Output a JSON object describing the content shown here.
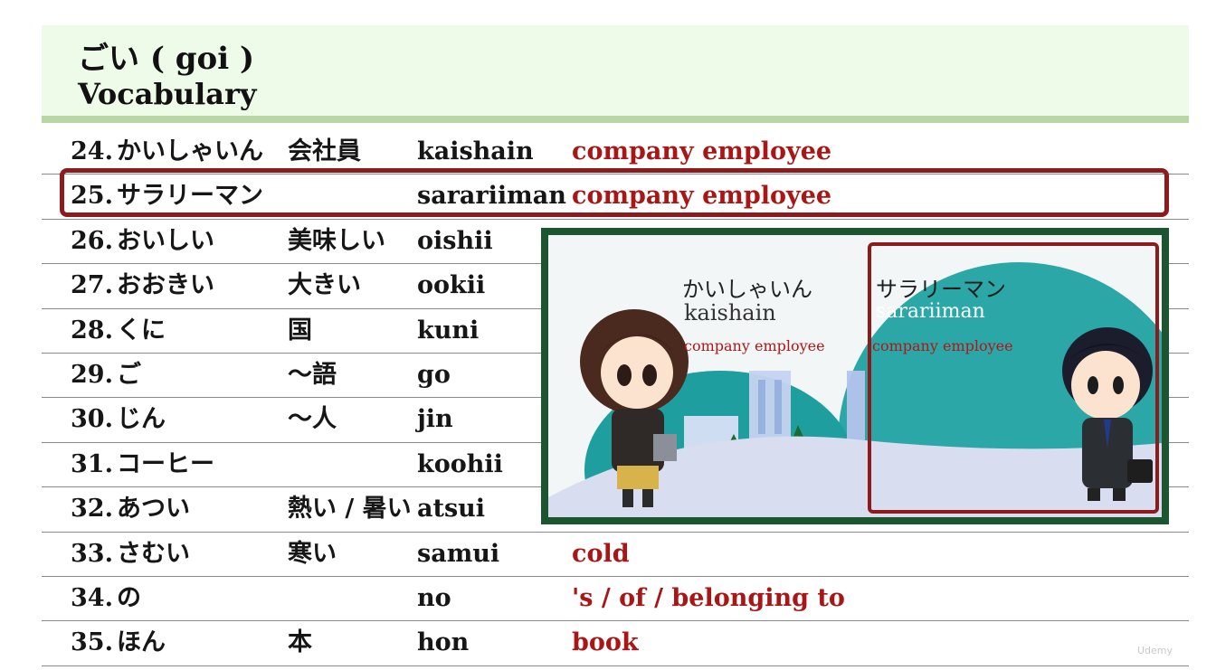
{
  "header": {
    "title_jp": "ごい ( goi )",
    "title_en": "Vocabulary"
  },
  "rows": [
    {
      "num": "24.",
      "kana": "かいしゃいん",
      "kanji": "会社員",
      "romaji": "kaishain",
      "english": "company employee"
    },
    {
      "num": "25.",
      "kana": "サラリーマン",
      "kanji": "",
      "romaji": "sarariiman",
      "english": "company employee"
    },
    {
      "num": "26.",
      "kana": "おいしい",
      "kanji": "美味しい",
      "romaji": "oishii",
      "english": ""
    },
    {
      "num": "27.",
      "kana": "おおきい",
      "kanji": "大きい",
      "romaji": "ookii",
      "english": ""
    },
    {
      "num": "28.",
      "kana": "くに",
      "kanji": "国",
      "romaji": "kuni",
      "english": ""
    },
    {
      "num": "29.",
      "kana": "ご",
      "kanji": "～語",
      "romaji": "go",
      "english": ""
    },
    {
      "num": "30.",
      "kana": "じん",
      "kanji": "～人",
      "romaji": "jin",
      "english": ""
    },
    {
      "num": "31.",
      "kana": "コーヒー",
      "kanji": "",
      "romaji": "koohii",
      "english": ""
    },
    {
      "num": "32.",
      "kana": "あつい",
      "kanji": "熱い / 暑い",
      "romaji": "atsui",
      "english": ""
    },
    {
      "num": "33.",
      "kana": "さむい",
      "kanji": "寒い",
      "romaji": "samui",
      "english": "cold"
    },
    {
      "num": "34.",
      "kana": "の",
      "kanji": "",
      "romaji": "no",
      "english": "'s / of / belonging to"
    },
    {
      "num": "35.",
      "kana": "ほん",
      "kanji": "本",
      "romaji": "hon",
      "english": "book"
    }
  ],
  "illustration": {
    "left_kana": "かいしゃいん",
    "left_romaji": "kaishain",
    "left_english": "company employee",
    "right_kana": "サラリーマン",
    "right_romaji": "sarariiman",
    "right_english": "company employee"
  },
  "watermark": "Udemy",
  "colors": {
    "header_bg": "#eefbe8",
    "header_rule": "#b8d7a4",
    "english_red": "#a81616",
    "highlight_border": "#8e1b1b",
    "illus_border": "#1e5531"
  }
}
